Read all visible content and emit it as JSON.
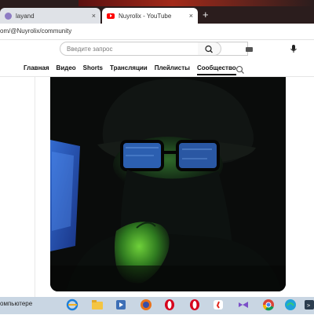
{
  "browser": {
    "tabs": [
      {
        "title": "layand",
        "active": false
      },
      {
        "title": "Nuyrolix - YouTube",
        "active": true
      }
    ],
    "close_glyph": "×",
    "new_tab_glyph": "+",
    "url": "om/@Nuyrolix/community"
  },
  "youtube": {
    "search_placeholder": "Введите запрос",
    "channel_tabs": [
      "Главная",
      "Видео",
      "Shorts",
      "Трансляции",
      "Плейлисты",
      "Сообщество"
    ],
    "active_tab": "Сообщество"
  },
  "post": {
    "image": "photo-person-in-cap-and-glasses-green-light"
  },
  "taskbar": {
    "status_text": "омпьютере",
    "apps": [
      "internet-explorer",
      "file-explorer",
      "media-player",
      "firefox",
      "opera",
      "opera",
      "yandex-browser",
      "visual-studio",
      "chrome",
      "edge",
      "terminal-app"
    ]
  },
  "colors": {
    "youtube_red": "#ff0000",
    "taskbar": "#c9d6e3"
  }
}
